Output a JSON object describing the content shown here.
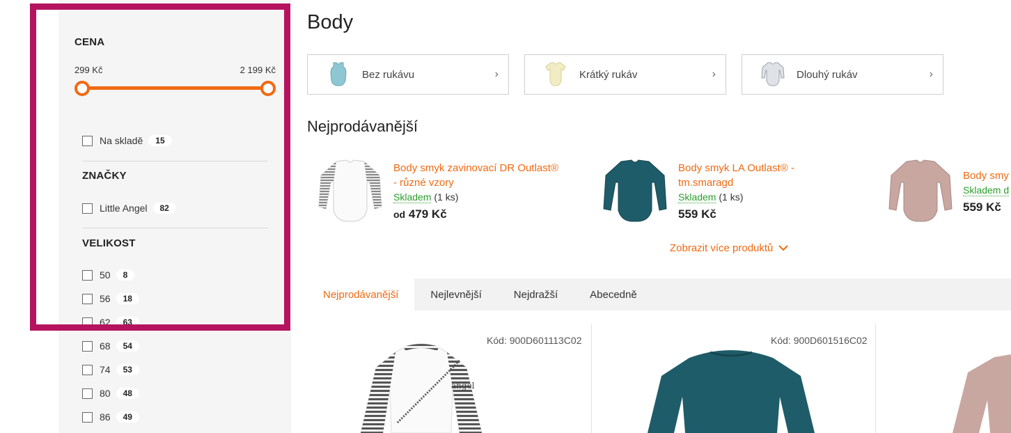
{
  "filters": {
    "price": {
      "title": "CENA",
      "min_label": "299 Kč",
      "max_label": "2 199 Kč"
    },
    "stock": {
      "label": "Na skladě",
      "count": "15"
    },
    "brands": {
      "title": "ZNAČKY",
      "items": [
        {
          "label": "Little Angel",
          "count": "82"
        }
      ]
    },
    "sizes": {
      "title": "VELIKOST",
      "items": [
        {
          "label": "50",
          "count": "8"
        },
        {
          "label": "56",
          "count": "18"
        },
        {
          "label": "62",
          "count": "63"
        },
        {
          "label": "68",
          "count": "54"
        },
        {
          "label": "74",
          "count": "53"
        },
        {
          "label": "80",
          "count": "48"
        },
        {
          "label": "86",
          "count": "49"
        }
      ]
    }
  },
  "page": {
    "title": "Body"
  },
  "categories": [
    {
      "label": "Bez rukávu",
      "icon": "sleeveless-bodysuit-icon",
      "color": "#8ec7d2"
    },
    {
      "label": "Krátký rukáv",
      "icon": "short-sleeve-bodysuit-icon",
      "color": "#f2ecc4"
    },
    {
      "label": "Dlouhý rukáv",
      "icon": "long-sleeve-bodysuit-icon",
      "color": "#c7ccd2"
    }
  ],
  "bestsellers": {
    "title": "Nejprodávanější",
    "items": [
      {
        "name_line1": "Body smyk zavinovací DR Outlast®",
        "name_line2": "- různé vzory",
        "stock": "Skladem",
        "qty": "(1 ks)",
        "price_prefix": "od",
        "price": "479 Kč"
      },
      {
        "name_line1": "Body smyk LA Outlast® -",
        "name_line2": "tm.smaragd",
        "stock": "Skladem",
        "qty": "(1 ks)",
        "price_prefix": "",
        "price": "559 Kč"
      },
      {
        "name_line1": "Body smy",
        "name_line2": "",
        "stock": "Skladem d",
        "qty": "",
        "price_prefix": "",
        "price": "559 Kč"
      }
    ],
    "more_label": "Zobrazit více produktů"
  },
  "sort_tabs": [
    {
      "label": "Nejprodávanější",
      "active": true
    },
    {
      "label": "Nejlevnější",
      "active": false
    },
    {
      "label": "Nejdražší",
      "active": false
    },
    {
      "label": "Abecedně",
      "active": false
    }
  ],
  "products": [
    {
      "code": "Kód: 900D601113C02"
    },
    {
      "code": "Kód: 900D601516C02"
    }
  ],
  "colors": {
    "accent": "#f06a12",
    "highlight_border": "#b5135f",
    "in_stock": "#2a9e2a",
    "teal_product": "#1f5c69",
    "rose_product": "#c9a7a1"
  }
}
